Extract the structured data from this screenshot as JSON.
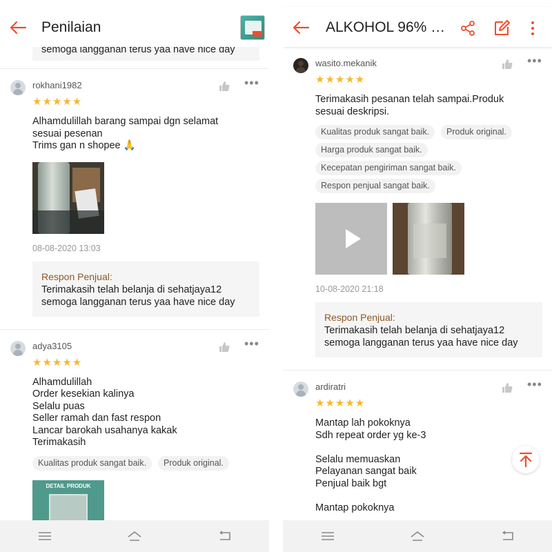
{
  "left": {
    "header": {
      "title": "Penilaian"
    },
    "top_partial_text": "semoga langganan terus yaa have nice day",
    "reviews": [
      {
        "username": "rokhani1982",
        "stars": "★★★★★",
        "text": "Alhamdulillah barang sampai dgn selamat\nsesuai pesenan\nTrims gan n shopee 🙏",
        "date": "08-08-2020 13:03",
        "reply_label": "Respon Penjual:",
        "reply_text": "Terimakasih telah belanja di sehatjaya12\nsemoga langganan terus yaa have nice day"
      },
      {
        "username": "adya3105",
        "stars": "★★★★★",
        "text": "Alhamdulillah\nOrder kesekian kalinya\nSelalu puas\nSeller ramah dan fast respon\nLancar barokah usahanya kakak\nTerimakasih",
        "tags": [
          "Kualitas produk sangat baik.",
          "Produk original."
        ],
        "photo_caption": "DETAIL PRODUK"
      }
    ]
  },
  "right": {
    "header": {
      "title": "ALKOHOL 96% 1..."
    },
    "reviews": [
      {
        "username": "wasito.mekanik",
        "stars": "★★★★★",
        "text": "Terimakasih pesanan telah sampai.Produk\nsesuai deskripsi.",
        "tags": [
          "Kualitas produk sangat baik.",
          "Produk original.",
          "Harga produk sangat baik.",
          "Kecepatan pengiriman sangat baik.",
          "Respon penjual sangat baik."
        ],
        "date": "10-08-2020 21:18",
        "reply_label": "Respon Penjual:",
        "reply_text": "Terimakasih telah belanja di sehatjaya12\nsemoga langganan terus yaa have nice day"
      },
      {
        "username": "ardiratri",
        "stars": "★★★★★",
        "text": "Mantap lah pokoknya\nSdh repeat order yg ke-3\n\nSelalu memuaskan\nPelayanan sangat baik\nPenjual baik bgt\n\nMantap pokoknya"
      }
    ]
  },
  "colors": {
    "accent": "#ee4d2d",
    "star": "#f8b72f",
    "seller_label": "#8a5a24"
  },
  "icons": [
    "back-arrow-icon",
    "share-icon",
    "edit-icon",
    "more-vertical-icon",
    "thumbs-up-icon",
    "more-horizontal-icon",
    "play-icon",
    "scroll-to-top-icon",
    "menu-icon",
    "home-icon",
    "back-nav-icon"
  ]
}
